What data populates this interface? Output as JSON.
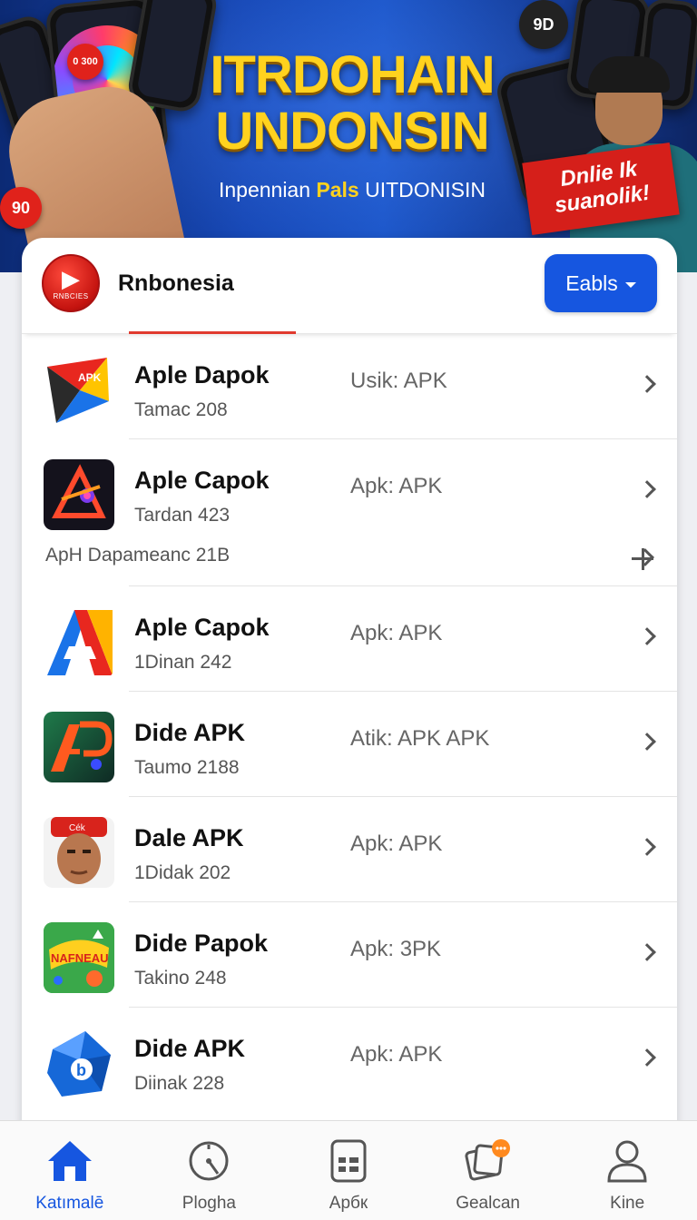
{
  "banner": {
    "title_line1": "ITRDOHAIN",
    "title_line2": "UNDONSIN",
    "subtitle_pre": "Inpennian",
    "subtitle_highlight": "Pals",
    "subtitle_post": "UITDONISIN",
    "promo_line1": "Dnlie Ik",
    "promo_line2": "suanolik!",
    "badge_left": "90",
    "badge_top_left": "0 300",
    "badge_top_right": "9D"
  },
  "header": {
    "brand_logo_text": "RNBCIES",
    "brand_name": "Rnbonesia",
    "dropdown_label": "Eabls"
  },
  "apps": [
    {
      "title": "Aple Dapok",
      "subtitle": "Tamac 208",
      "type": "Usik: APK",
      "icon": "red-paper-plane-icon"
    },
    {
      "title": "Aple Capok",
      "subtitle": "Tardan 423",
      "type": "Apk: APK",
      "icon": "dark-abstract-app-icon"
    },
    {
      "title": "Aple Capok",
      "subtitle": "1Dinan 242",
      "type": "Apk: APK",
      "icon": "letter-a-app-icon"
    },
    {
      "title": "Dide APK",
      "subtitle": "Taumo 2188",
      "type": "Atik: APK APK",
      "icon": "ap-logo-app-icon"
    },
    {
      "title": "Dale APK",
      "subtitle": "1Didak 202",
      "type": "Apk: APK",
      "icon": "man-portrait-app-icon"
    },
    {
      "title": "Dide Papok",
      "subtitle": "Takino 248",
      "type": "Apk: 3PK",
      "icon": "game-app-icon"
    },
    {
      "title": "Dide APK",
      "subtitle": "Diinak 228",
      "type": "Apk: APK",
      "icon": "blue-cube-app-icon"
    }
  ],
  "extra_row": {
    "label": "ApH Dapameanc 21B"
  },
  "nav": [
    {
      "label": "Katımalē",
      "icon": "home-icon",
      "active": true
    },
    {
      "label": "Plogha",
      "icon": "gauge-icon",
      "active": false
    },
    {
      "label": "Apбк",
      "icon": "document-icon",
      "active": false
    },
    {
      "label": "Gealcan",
      "icon": "chat-cards-icon",
      "active": false
    },
    {
      "label": "Kine",
      "icon": "profile-icon",
      "active": false
    }
  ],
  "colors": {
    "accent": "#1656e0",
    "banner_blue": "#1748b6",
    "title_yellow": "#ffd21e",
    "brand_red": "#e03a2e"
  }
}
